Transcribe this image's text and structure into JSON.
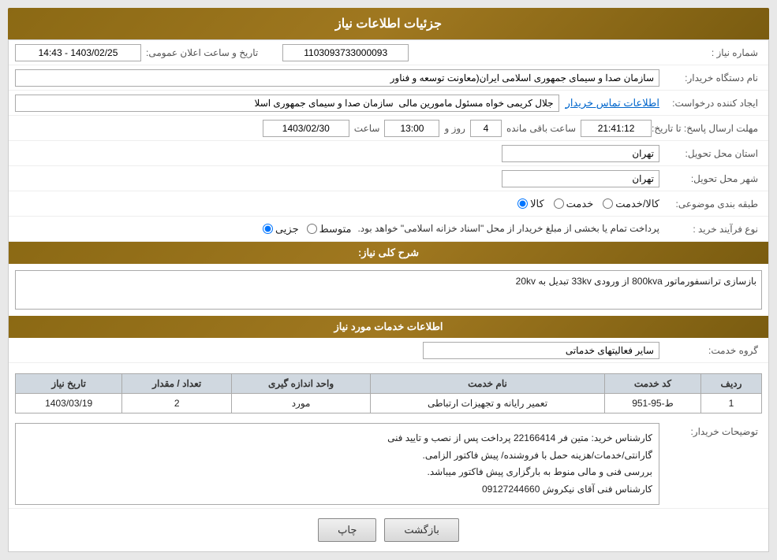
{
  "header": {
    "title": "جزئیات اطلاعات نیاز"
  },
  "fields": {
    "need_number_label": "شماره نیاز :",
    "need_number_value": "1103093733000093",
    "buyer_org_label": "نام دستگاه خریدار:",
    "buyer_org_value": "سازمان صدا و سیمای جمهوری اسلامی ایران(معاونت توسعه و فناور",
    "creator_label": "ایجاد کننده درخواست:",
    "creator_value": "جلال کریمی خواه مسئول مامورین مالی  سازمان صدا و سیمای جمهوری اسلا",
    "creator_link": "اطلاعات تماس خریدار",
    "send_date_label": "مهلت ارسال پاسخ: تا تاریخ:",
    "send_date_value": "1403/02/30",
    "send_time_label": "ساعت",
    "send_time_value": "13:00",
    "days_label": "روز و",
    "days_value": "4",
    "remaining_label": "ساعت باقی مانده",
    "remaining_value": "21:41:12",
    "announce_label": "تاریخ و ساعت اعلان عمومی:",
    "announce_value": "1403/02/25 - 14:43",
    "province_label": "استان محل تحویل:",
    "province_value": "تهران",
    "city_label": "شهر محل تحویل:",
    "city_value": "تهران",
    "category_label": "طبقه بندی موضوعی:",
    "category_options": [
      "کالا",
      "خدمت",
      "کالا/خدمت"
    ],
    "category_selected": "کالا",
    "process_label": "نوع فرآیند خرید :",
    "process_options": [
      "جزیی",
      "متوسط"
    ],
    "process_note": "پرداخت تمام یا بخشی از مبلغ خریدار از محل \"اسناد خزانه اسلامی\" خواهد بود.",
    "need_desc_label": "شرح کلی نیاز:",
    "need_desc_value": "بازسازی ترانسفورماتور 800kva از ورودی 33kv تبدیل به 20kv",
    "services_header": "اطلاعات خدمات مورد نیاز",
    "service_group_label": "گروه خدمت:",
    "service_group_value": "سایر فعالیتهای خدماتی",
    "table": {
      "columns": [
        "ردیف",
        "کد خدمت",
        "نام خدمت",
        "واحد اندازه گیری",
        "تعداد / مقدار",
        "تاریخ نیاز"
      ],
      "rows": [
        {
          "row": "1",
          "code": "ط-95-951",
          "name": "تعمیر رایانه و تجهیزات ارتباطی",
          "unit": "مورد",
          "qty": "2",
          "date": "1403/03/19"
        }
      ]
    },
    "buyer_notes_label": "توضیحات خریدار:",
    "buyer_notes_value": "کارشناس خرید: متین فر 22166414  پرداخت پس از نصب و تایید فنی\nگارانتی/خدمات/هزینه حمل با فروشنده/ پیش فاکتور الزامی.\nبررسی فنی و مالی منوط به بارگزاری پیش فاکتور میباشد.\nکارشناس فنی آقای نیکروش 09127244660",
    "btn_back": "بازگشت",
    "btn_print": "چاپ"
  }
}
